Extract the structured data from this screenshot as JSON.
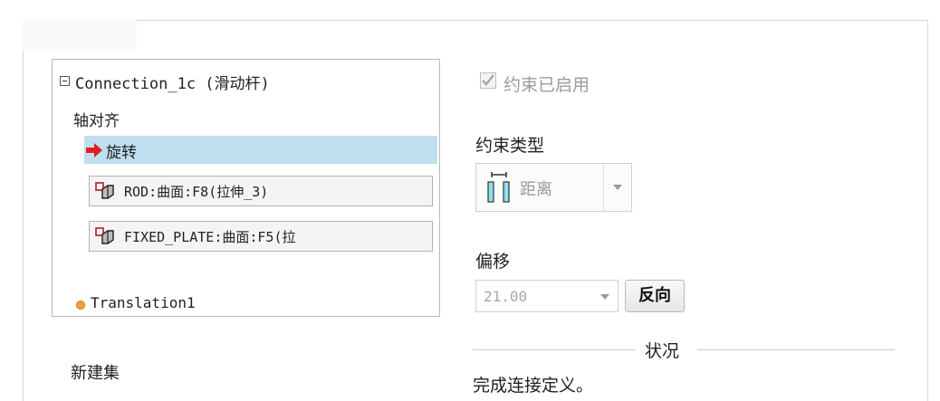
{
  "tree": {
    "root_label": "Connection_1c (滑动杆)",
    "axis_align": "轴对齐",
    "rotation": "旋转",
    "refs": [
      {
        "label": "ROD:曲面:F8(拉伸_3)"
      },
      {
        "label": "FIXED_PLATE:曲面:F5(拉"
      }
    ],
    "translation": "Translation1",
    "new_set": "新建集"
  },
  "constraint_enabled": {
    "label": "约束已启用",
    "checked": true
  },
  "constraint_type": {
    "label": "约束类型",
    "value": "距离"
  },
  "offset": {
    "label": "偏移",
    "value": "21.00",
    "flip_label": "反向"
  },
  "status": {
    "legend": "状况",
    "message": "完成连接定义。"
  },
  "colors": {
    "selection": "#bfdfef",
    "arrow": "#e02020",
    "icon_blue": "#8fe0f0"
  }
}
